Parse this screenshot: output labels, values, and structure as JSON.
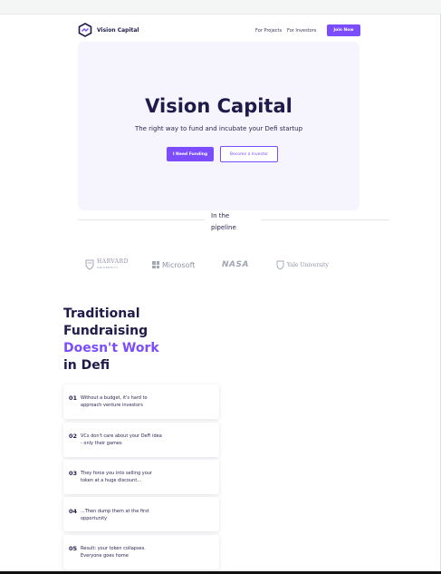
{
  "brand": {
    "name": "Vision Capital"
  },
  "nav": {
    "projects": "For Projects",
    "investors": "For Investors",
    "join": "Join Now"
  },
  "hero": {
    "title": "Vision Capital",
    "subtitle": "The right way to fund and incubate your Defi startup",
    "primary_button": "I Need Funding",
    "secondary_button": "Become a Investor"
  },
  "pipeline": {
    "line1": "In the",
    "line2": "pipeline"
  },
  "partners": {
    "harvard": {
      "name": "HARVARD",
      "sub": "UNIVERSITY"
    },
    "microsoft": "Microsoft",
    "nasa": "NASA",
    "yale": "Yale University"
  },
  "section": {
    "title_line1": "Traditional",
    "title_line2": "Fundraising",
    "title_accent": "Doesn't Work",
    "title_line4": "in Defi"
  },
  "problems": [
    {
      "num": "01",
      "line1": "Without a budget, it's hard to",
      "line2": "approach venture investors"
    },
    {
      "num": "02",
      "line1": "VCs don't care about your DeFi idea",
      "line2": "- only their games"
    },
    {
      "num": "03",
      "line1": "They force you into selling your",
      "line2": "token at a huge discount..."
    },
    {
      "num": "04",
      "line1": "...Then dump them at the first",
      "line2": "opportunity"
    },
    {
      "num": "05",
      "line1": "Result: your token collapses.",
      "line2": "Everyone goes home"
    }
  ],
  "colors": {
    "accent": "#7c4dff",
    "navy": "#1e1b4b",
    "hero_bg": "#f6f4fd"
  }
}
